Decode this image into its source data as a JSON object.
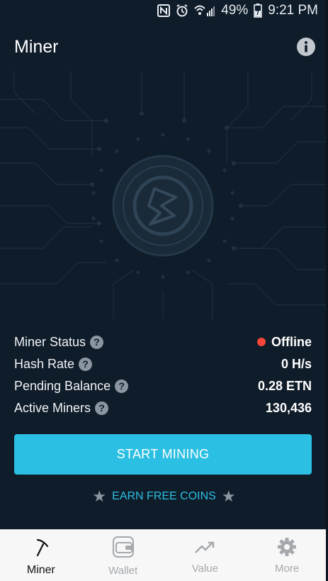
{
  "status_bar": {
    "battery": "49%",
    "time": "9:21 PM"
  },
  "header": {
    "title": "Miner"
  },
  "stats": [
    {
      "label": "Miner Status",
      "value": "Offline",
      "status_color": "#f2473a"
    },
    {
      "label": "Hash Rate",
      "value": "0 H/s"
    },
    {
      "label": "Pending Balance",
      "value": "0.28 ETN"
    },
    {
      "label": "Active Miners",
      "value": "130,436"
    }
  ],
  "start_button": {
    "label": "START MINING"
  },
  "earn_link": {
    "label": "EARN FREE COINS"
  },
  "bottom_nav": [
    {
      "label": "Miner",
      "icon": "pickaxe-icon",
      "active": true
    },
    {
      "label": "Wallet",
      "icon": "wallet-icon",
      "active": false
    },
    {
      "label": "Value",
      "icon": "trend-up-icon",
      "active": false
    },
    {
      "label": "More",
      "icon": "gear-icon",
      "active": false
    }
  ],
  "colors": {
    "accent": "#2bbfe3",
    "background": "#0f1c29",
    "offline": "#f2473a"
  }
}
